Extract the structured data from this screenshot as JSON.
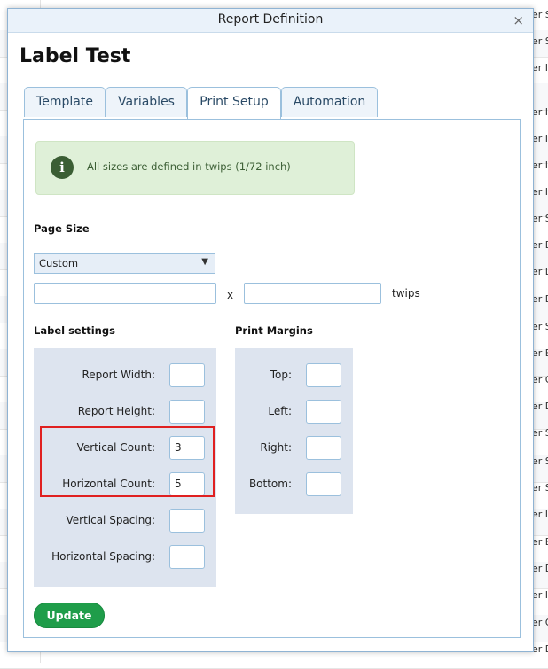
{
  "background": {
    "right_fragments": [
      "er S",
      "er S",
      "er In",
      "er In",
      "er In",
      "er In",
      "er In",
      "er S",
      "er D",
      "er D",
      "er D",
      "er S",
      "er E",
      "er O",
      "er D",
      "er S",
      "er S",
      "er S",
      "er In",
      "er E",
      "er D",
      "er In",
      "er O",
      "er D"
    ]
  },
  "dialog": {
    "title": "Report Definition",
    "close_label": "×",
    "report_name": "Label Test",
    "tabs": [
      {
        "label": "Template",
        "active": false
      },
      {
        "label": "Variables",
        "active": false
      },
      {
        "label": "Print Setup",
        "active": true
      },
      {
        "label": "Automation",
        "active": false
      }
    ],
    "info": {
      "icon": "info-icon",
      "icon_glyph": "i",
      "text": "All sizes are defined in twips (1/72 inch)"
    },
    "page_size": {
      "heading": "Page Size",
      "select_value": "Custom",
      "width_value": "",
      "height_value": "",
      "separator": "x",
      "unit": "twips"
    },
    "label_settings": {
      "heading": "Label settings",
      "fields": [
        {
          "label": "Report Width:",
          "value": ""
        },
        {
          "label": "Report Height:",
          "value": ""
        },
        {
          "label": "Vertical Count:",
          "value": "3"
        },
        {
          "label": "Horizontal Count:",
          "value": "5"
        },
        {
          "label": "Vertical Spacing:",
          "value": ""
        },
        {
          "label": "Horizontal Spacing:",
          "value": ""
        }
      ]
    },
    "print_margins": {
      "heading": "Print Margins",
      "fields": [
        {
          "label": "Top:",
          "value": ""
        },
        {
          "label": "Left:",
          "value": ""
        },
        {
          "label": "Right:",
          "value": ""
        },
        {
          "label": "Bottom:",
          "value": ""
        }
      ]
    },
    "update_label": "Update"
  },
  "colors": {
    "accent_button": "#1f9d4a",
    "highlight_border": "#e02020",
    "info_background": "#dff0d8"
  }
}
